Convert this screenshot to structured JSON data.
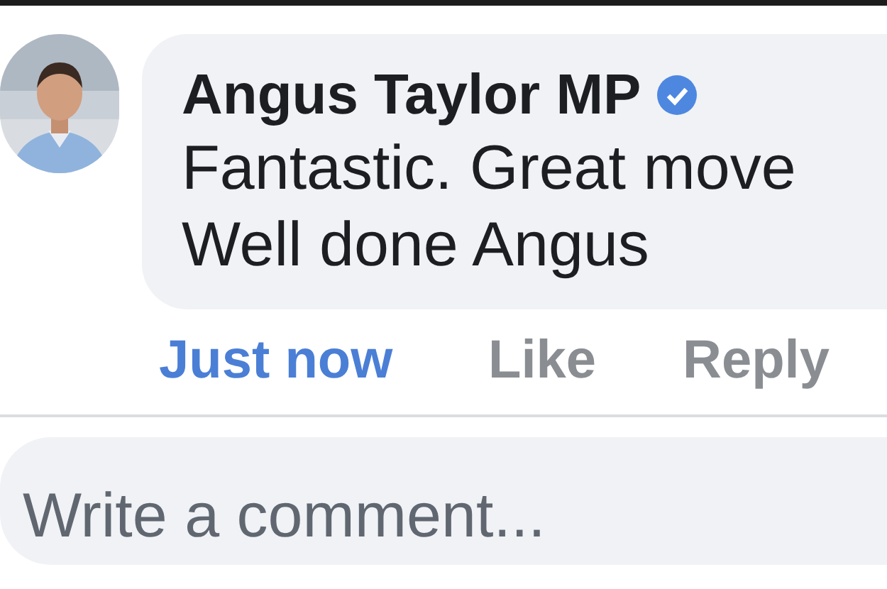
{
  "comment": {
    "author": "Angus Taylor MP",
    "verified": true,
    "lines": [
      "Fantastic. Great move",
      "Well done Angus"
    ]
  },
  "actions": [
    {
      "label": "Just now",
      "kind": "time"
    },
    {
      "label": "Like",
      "kind": "action"
    },
    {
      "label": "Reply",
      "kind": "action"
    }
  ],
  "composer": {
    "placeholder": "Write a comment..."
  }
}
